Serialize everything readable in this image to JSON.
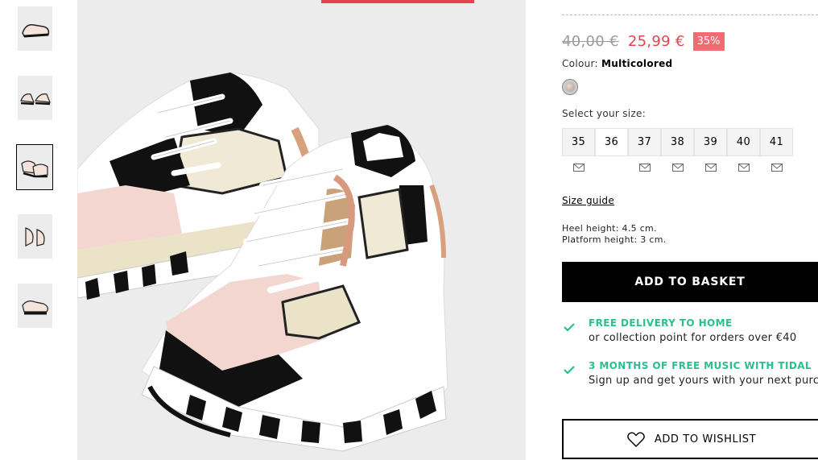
{
  "thumbnails": [
    {
      "name": "thumb-1"
    },
    {
      "name": "thumb-2"
    },
    {
      "name": "thumb-3",
      "active": true
    },
    {
      "name": "thumb-4"
    },
    {
      "name": "thumb-5"
    }
  ],
  "product": {
    "old_price": "40,00 €",
    "new_price": "25,99 €",
    "discount": "35%",
    "colour_label": "Colour:",
    "colour_value": "Multicolored",
    "size_label": "Select your size:",
    "sizes": [
      "35",
      "36",
      "37",
      "38",
      "39",
      "40",
      "41"
    ],
    "selected_size": "36",
    "size_guide": "Size guide",
    "heel_height": "Heel height: 4.5 cm.",
    "platform_height": "Platform height: 3 cm.",
    "add_to_basket": "ADD TO BASKET",
    "add_to_wishlist": "ADD TO WISHLIST"
  },
  "perks": [
    {
      "title": "FREE DELIVERY TO HOME",
      "sub": "or collection point for orders over €40"
    },
    {
      "title": "3 MONTHS OF FREE MUSIC WITH TIDAL",
      "sub": "Sign up and get yours with your next purchase"
    }
  ],
  "colors": {
    "accent_red": "#e5434f",
    "discount_bg": "#f26a72",
    "perk_green": "#2bbf8f"
  },
  "icons": {
    "notify": "envelope-icon",
    "check": "check-icon",
    "wishlist": "heart-icon"
  }
}
